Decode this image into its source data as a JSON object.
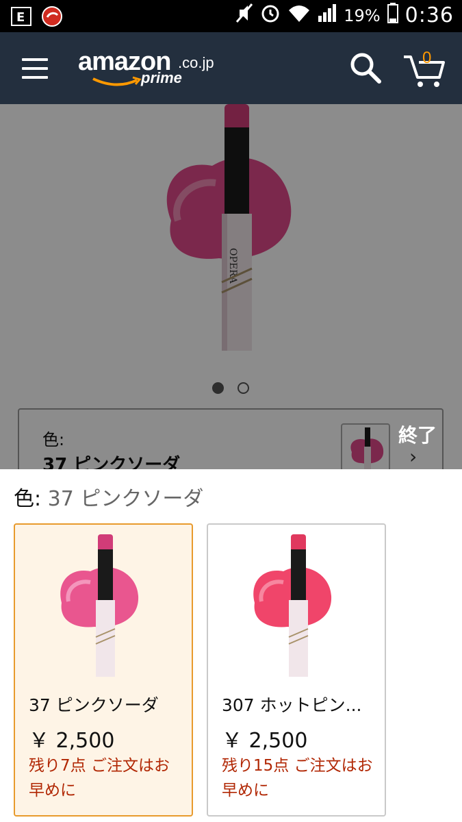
{
  "status_bar": {
    "battery_pct": "19%",
    "time": "0:36"
  },
  "header": {
    "logo_main": "amazon",
    "logo_suffix": ".co.jp",
    "logo_prime": "prime",
    "cart_count": "0"
  },
  "product": {
    "carousel_pages": 2,
    "carousel_active": 1,
    "color_label": "色:",
    "color_value": "37 ピンクソーダ",
    "done_label": "終了"
  },
  "sheet": {
    "title_key": "色:",
    "title_value": "37 ピンクソーダ",
    "options": [
      {
        "name": "37 ピンクソーダ",
        "price": "￥ 2,500",
        "stock": "残り7点 ご注文はお早めに",
        "selected": true,
        "swatch_color": "#e9568f"
      },
      {
        "name": "307 ホットピン...",
        "price": "￥ 2,500",
        "stock": "残り15点 ご注文はお早めに",
        "selected": false,
        "swatch_color": "#f0456a"
      }
    ]
  },
  "colors": {
    "header_bg": "#232f3e",
    "accent_orange": "#f90",
    "selected_border": "#e89a2c",
    "stock_red": "#b12704"
  }
}
